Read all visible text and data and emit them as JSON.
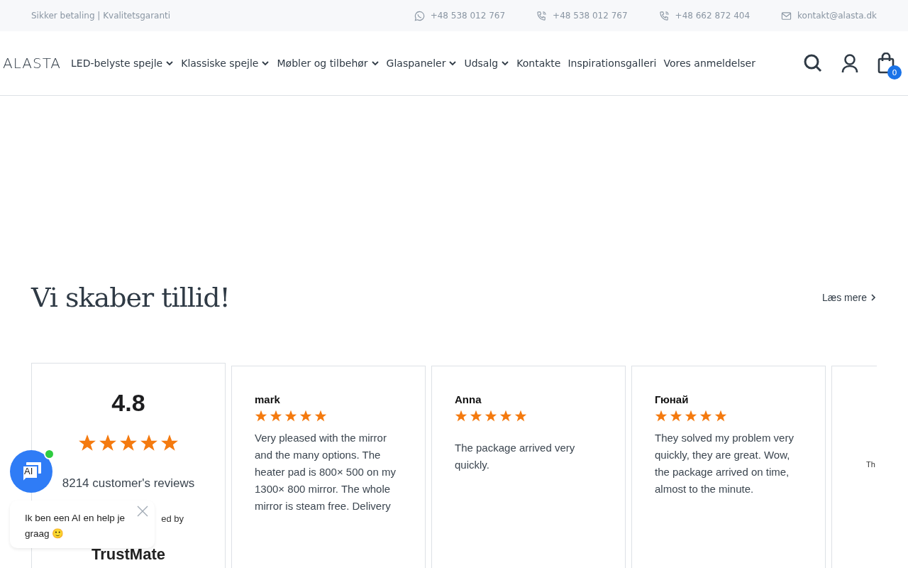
{
  "top_bar": {
    "tagline": "Sikker betaling | Kvalitetsgaranti",
    "contacts": [
      {
        "kind": "whatsapp",
        "text": "+48 538 012 767"
      },
      {
        "kind": "phone",
        "text": "+48 538 012 767"
      },
      {
        "kind": "phone",
        "text": "+48 662 872 404"
      },
      {
        "kind": "mail",
        "text": "kontakt@alasta.dk"
      }
    ]
  },
  "nav": {
    "logo": "ALASTA",
    "items": [
      {
        "label": "LED-belyste spejle",
        "dropdown": true
      },
      {
        "label": "Klassiske spejle",
        "dropdown": true
      },
      {
        "label": "Møbler og tilbehør",
        "dropdown": true
      },
      {
        "label": "Glaspaneler",
        "dropdown": true
      },
      {
        "label": "Udsalg",
        "dropdown": true
      },
      {
        "label": "Kontakte",
        "dropdown": false
      },
      {
        "label": "Inspirationsgalleri",
        "dropdown": false
      },
      {
        "label": "Vores anmeldelser",
        "dropdown": false
      }
    ],
    "cart_count": "0"
  },
  "section": {
    "title": "Vi skaber tillid!",
    "link": "Læs mere"
  },
  "summary": {
    "rating": "4.8",
    "stars": 5,
    "count": "8214 customer's reviews",
    "powered_by": "ed by",
    "brand": "TrustMate"
  },
  "reviews": [
    {
      "name": "mark",
      "stars": 5,
      "text": "Very pleased with the mirror and the many options. The heater pad is 800× 500 on my 1300× 800 mirror. The whole mirror is steam free. Delivery"
    },
    {
      "name": "Anna",
      "stars": 5,
      "text": "The package arrived very quickly."
    },
    {
      "name": "Гюнай",
      "stars": 5,
      "text": "They solved my problem very quickly, they are great. Wow, the package arrived on time, almost to the minute."
    },
    {
      "kind": "partial",
      "text": "Th"
    }
  ],
  "chat": {
    "badge": "AI",
    "online": true,
    "message": "Ik ben een AI en help je graag 🙂"
  }
}
